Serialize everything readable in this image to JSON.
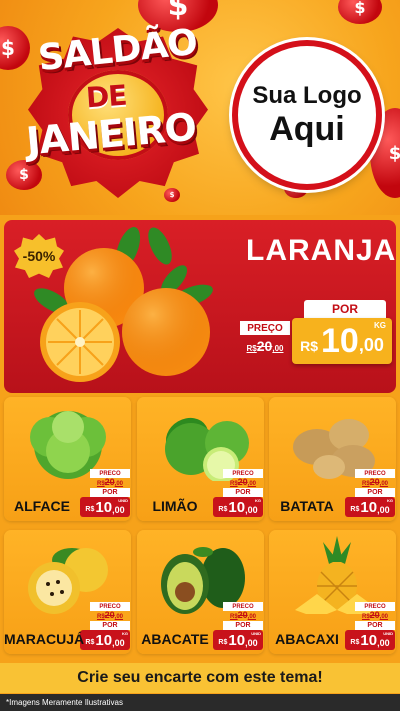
{
  "banner": {
    "title_line1": "SALDÃO",
    "title_line2": "DE",
    "title_line3": "JANEIRO",
    "logo_line1": "Sua Logo",
    "logo_line2": "Aqui",
    "coin_symbol": "$"
  },
  "featured": {
    "discount": "-50%",
    "name": "LARANJA",
    "old_label": "PREÇO",
    "old_currency": "R$",
    "old_price": "20",
    "old_cents": ",00",
    "por_label": "POR",
    "currency": "R$",
    "price_int": "10",
    "price_dec": ",00",
    "unit": "KG",
    "icon": "orange-image"
  },
  "products": [
    {
      "name": "ALFACE",
      "old_label": "PRECO",
      "old_currency": "R$",
      "old_price": "20",
      "old_cents": ",00",
      "por_label": "POR",
      "currency": "R$",
      "price_int": "10",
      "price_dec": ",00",
      "unit": "UNID",
      "icon": "lettuce-image"
    },
    {
      "name": "LIMÃO",
      "old_label": "PRECO",
      "old_currency": "R$",
      "old_price": "20",
      "old_cents": ",00",
      "por_label": "POR",
      "currency": "R$",
      "price_int": "10",
      "price_dec": ",00",
      "unit": "KG",
      "icon": "lime-image"
    },
    {
      "name": "BATATA",
      "old_label": "PRECO",
      "old_currency": "R$",
      "old_price": "20",
      "old_cents": ",00",
      "por_label": "POR",
      "currency": "R$",
      "price_int": "10",
      "price_dec": ",00",
      "unit": "KG",
      "icon": "potato-image"
    },
    {
      "name": "MARACUJÁ",
      "old_label": "PRECO",
      "old_currency": "R$",
      "old_price": "20",
      "old_cents": ",00",
      "por_label": "POR",
      "currency": "R$",
      "price_int": "10",
      "price_dec": ",00",
      "unit": "KG",
      "icon": "passion-fruit-image"
    },
    {
      "name": "ABACATE",
      "old_label": "PRECO",
      "old_currency": "R$",
      "old_price": "20",
      "old_cents": ",00",
      "por_label": "POR",
      "currency": "R$",
      "price_int": "10",
      "price_dec": ",00",
      "unit": "UNID",
      "icon": "avocado-image"
    },
    {
      "name": "ABACAXI",
      "old_label": "PRECO",
      "old_currency": "R$",
      "old_price": "20",
      "old_cents": ",00",
      "por_label": "POR",
      "currency": "R$",
      "price_int": "10",
      "price_dec": ",00",
      "unit": "UNID",
      "icon": "pineapple-image"
    }
  ],
  "footer": {
    "cta": "Crie seu encarte com este tema!",
    "disclaimer": "*Imagens Meramente Ilustrativas"
  },
  "colors": {
    "brand_red": "#c8121b",
    "brand_orange": "#f7a51d",
    "brand_yellow": "#f9c234"
  }
}
